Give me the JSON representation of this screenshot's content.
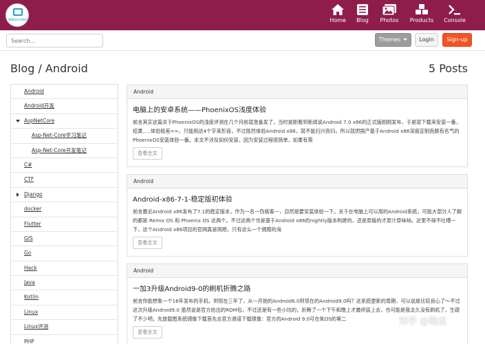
{
  "nav": {
    "logo_text": "博客园合并群组",
    "items": [
      {
        "label": "Home",
        "icon": "home-icon"
      },
      {
        "label": "Blog",
        "icon": "list-icon"
      },
      {
        "label": "Photos",
        "icon": "photos-icon"
      },
      {
        "label": "Products",
        "icon": "cubes-icon"
      },
      {
        "label": "Console",
        "icon": "terminal-icon"
      }
    ]
  },
  "toolbar": {
    "search_placeholder": "Search...",
    "themes_label": "Themes",
    "login_label": "Login",
    "signup_label": "Sign-up"
  },
  "header": {
    "title": "Blog / Android",
    "count": "5 Posts"
  },
  "sidebar": {
    "items": [
      {
        "label": "Android"
      },
      {
        "label": "Android开发"
      },
      {
        "label": "AspNetCore"
      },
      {
        "label": "Asp-Net-Core学习笔记"
      },
      {
        "label": "Asp-Net-Core开发笔记"
      },
      {
        "label": "C#"
      },
      {
        "label": "CTF"
      },
      {
        "label": "Django"
      },
      {
        "label": "docker"
      },
      {
        "label": "Flutter"
      },
      {
        "label": "GIS"
      },
      {
        "label": "Go"
      },
      {
        "label": "Hack"
      },
      {
        "label": "Java"
      },
      {
        "label": "Kotlin"
      },
      {
        "label": "Linux"
      },
      {
        "label": "Linux评测"
      },
      {
        "label": "PHP"
      }
    ]
  },
  "posts": [
    {
      "category": "Android",
      "title": "电脑上的安卓系统——PhoenixOS浅度体验",
      "excerpt": "前言其实这篇关于PhoenixOS的浅度评测在几个月前就准备发了，当时是刚看到新闻说Android 7.0 x86的正式版刚刚发布，于是就下载来安装一番，结果.....体验极差==，只能用这4个字来形容，不过既然体验Android x86，就不能扫兴而归，所以就把国产基于Android x86深度定制而颇有名气的PhoenixOS安装体验一番。本文不涉及如何安装，因为安装过程很简单，如果有需",
      "more": "查看全文"
    },
    {
      "category": "Android",
      "title": "Android-x86-7-1-稳定版初体验",
      "excerpt": "前言最近Android x86发布了7.1的稳定版本，作为一名一伪极客一，自然是要安装体验一下。关于在电脑上可以用的Android系统，可能大部分人了解的都是 Remix OS 和 Phoenix OS 这两个。不过这两个也是基于Android x86的nightly版本构建的，还是原版的才原汁原味呐。这里不得不吐槽一下，这个Android x86项目的官网真是简陋，只有这么一个捐赠的海",
      "more": "查看全文"
    },
    {
      "category": "Android",
      "title": "一加3升级Android9-0的刷机折腾之路",
      "excerpt": "前言你能想象一个16年发布的手机，到现在三年了，从一开始的Android6.0到现在的Android9.0吗？这系统更新的周期，可以说是比较良心了～不过这次升级Android9.0 虽然说是官方给出的ROM包，不过还是有一些小坑的，折腾了一个下午和晚上才最终装上去，也可能是我太久没有刷机了，生疏了不少吧。先放截图系统镜像下载首先去官方通道下载镜像：官方的Android 9.0可在氧OS的第二",
      "more": "查看全文"
    }
  ],
  "watermark": "知乎 @曦远"
}
